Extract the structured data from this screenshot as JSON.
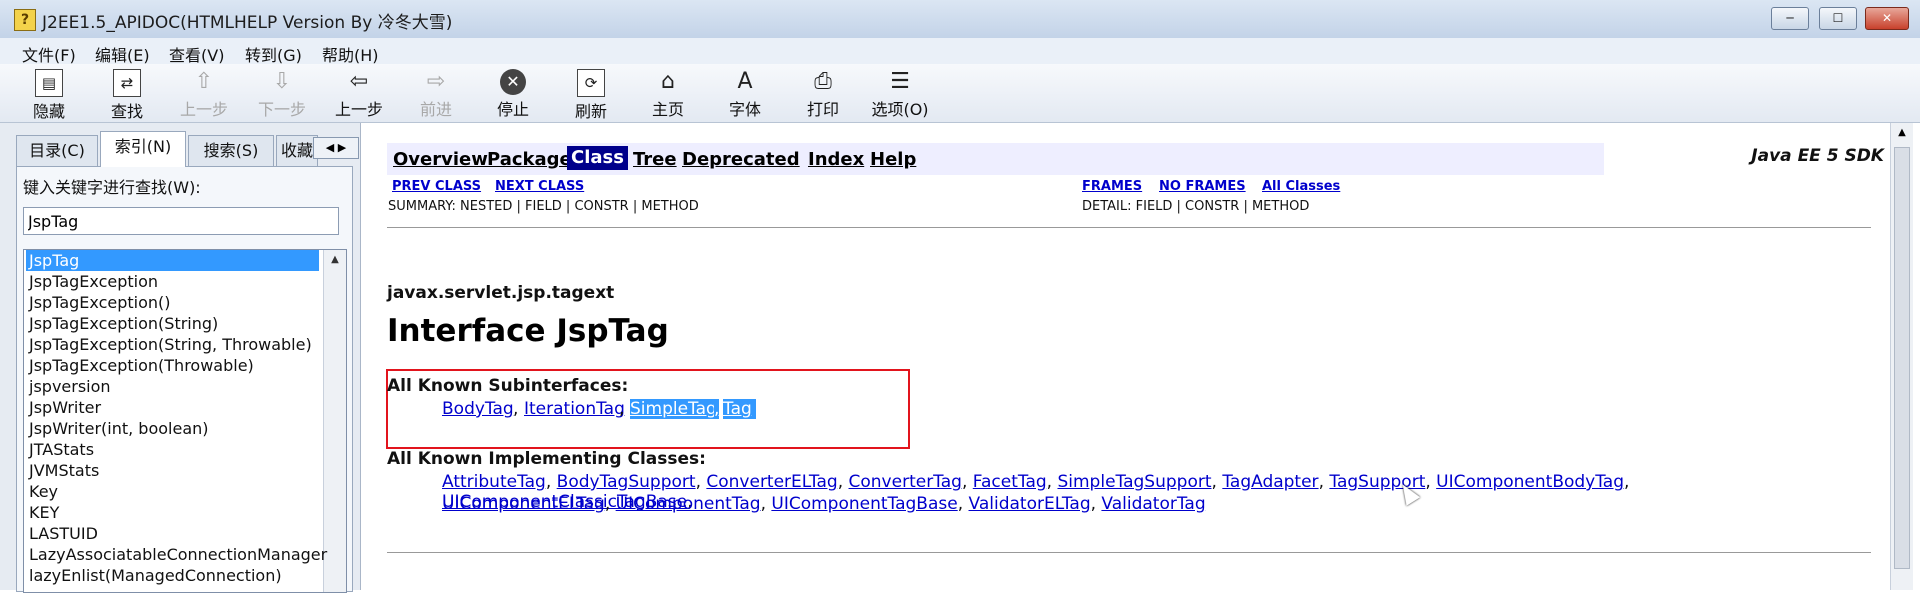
{
  "window": {
    "title": "J2EE1.5_APIDOC(HTMLHELP Version By 冷冬大雪)",
    "icon": "help-book-icon",
    "minimize": "─",
    "maximize": "☐",
    "close": "✕"
  },
  "menu": [
    "文件(F)",
    "编辑(E)",
    "查看(V)",
    "转到(G)",
    "帮助(H)"
  ],
  "toolbar": [
    {
      "label": "隐藏",
      "icon": "hide-pane-icon",
      "glyph": "▤",
      "enabled": true
    },
    {
      "label": "查找",
      "icon": "locate-icon",
      "glyph": "⇄",
      "enabled": true
    },
    {
      "label": "上一步",
      "icon": "up-arrow-icon",
      "glyph": "⇧",
      "enabled": false
    },
    {
      "label": "下一步",
      "icon": "down-arrow-icon",
      "glyph": "⇩",
      "enabled": false
    },
    {
      "label": "上一步",
      "icon": "back-arrow-icon",
      "glyph": "⇦",
      "enabled": true
    },
    {
      "label": "前进",
      "icon": "forward-arrow-icon",
      "glyph": "⇨",
      "enabled": false
    },
    {
      "label": "停止",
      "icon": "stop-icon",
      "glyph": "✕",
      "enabled": true
    },
    {
      "label": "刷新",
      "icon": "refresh-icon",
      "glyph": "⟳",
      "enabled": true
    },
    {
      "label": "主页",
      "icon": "home-icon",
      "glyph": "⌂",
      "enabled": true
    },
    {
      "label": "字体",
      "icon": "font-icon",
      "glyph": "A",
      "enabled": true
    },
    {
      "label": "打印",
      "icon": "print-icon",
      "glyph": "⎙",
      "enabled": true
    },
    {
      "label": "选项(O)",
      "icon": "options-icon",
      "glyph": "☰",
      "enabled": true
    }
  ],
  "leftpane": {
    "tabs": [
      "目录(C)",
      "索引(N)",
      "搜索(S)",
      "收藏"
    ],
    "active_tab": 1,
    "tab_arrows": "◀ ▶",
    "keyword_label": "键入关键字进行查找(W):",
    "keyword_value": "JspTag",
    "index_items": [
      "JspTag",
      "JspTagException",
      "JspTagException()",
      "JspTagException(String)",
      "JspTagException(String, Throwable)",
      "JspTagException(Throwable)",
      "jspversion",
      "JspWriter",
      "JspWriter(int, boolean)",
      "JTAStats",
      "JVMStats",
      "Key",
      "KEY",
      "LASTUID",
      "LazyAssociatableConnectionManager",
      "lazyEnlist(ManagedConnection)"
    ],
    "selected_index": 0
  },
  "content": {
    "nav": [
      "Overview",
      "Package",
      "Class",
      "Tree",
      "Deprecated",
      "Index",
      "Help"
    ],
    "nav_current": "Class",
    "sdk": "Java EE 5 SDK",
    "prev_class": "PREV CLASS",
    "next_class": "NEXT CLASS",
    "frames": "FRAMES",
    "no_frames": "NO FRAMES",
    "all_classes": "All Classes",
    "summary": "SUMMARY: NESTED | FIELD | CONSTR | METHOD",
    "detail": "DETAIL: FIELD | CONSTR | METHOD",
    "package": "javax.servlet.jsp.tagext",
    "heading": "Interface JspTag",
    "subinterfaces_title": "All Known Subinterfaces:",
    "subinterfaces": [
      "BodyTag",
      "IterationTag",
      "SimpleTag",
      "Tag"
    ],
    "implementing_title": "All Known Implementing Classes:",
    "implementing_row1": [
      "AttributeTag",
      "BodyTagSupport",
      "ConverterELTag",
      "ConverterTag",
      "FacetTag",
      "SimpleTagSupport",
      "TagAdapter",
      "TagSupport",
      "UIComponentBodyTag",
      "UIComponentClassicTagBase"
    ],
    "implementing_row2": [
      "UIComponentELTag",
      "UIComponentTag",
      "UIComponentTagBase",
      "ValidatorELTag",
      "ValidatorTag"
    ]
  },
  "colors": {
    "nav_current_bg": "#00008b",
    "nav_bar_bg": "#eeeeff",
    "highlight": "#3399ff",
    "link": "#0000cc",
    "annotation_box": "#e2141d"
  }
}
